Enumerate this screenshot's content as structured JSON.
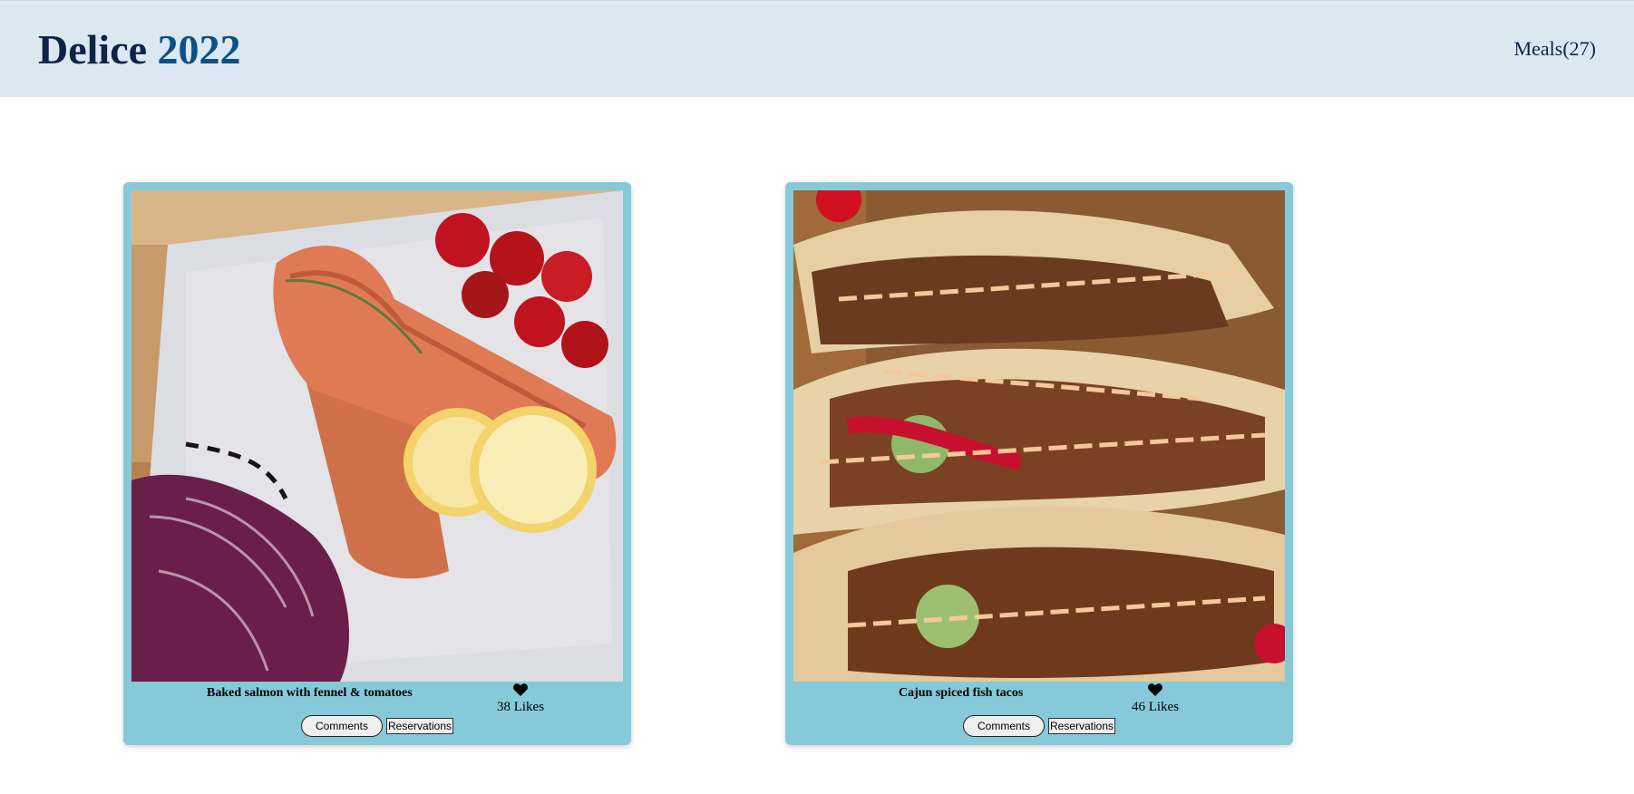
{
  "header": {
    "brand_name": "Delice",
    "brand_year": "2022",
    "nav_meals": "Meals(27)"
  },
  "meals": [
    {
      "title": "Baked salmon with fennel & tomatoes",
      "likes": "38 Likes",
      "comments_label": "Comments",
      "reservations_label": "Reservations",
      "image_icon": "food-photo-salmon"
    },
    {
      "title": "Cajun spiced fish tacos",
      "likes": "46 Likes",
      "comments_label": "Comments",
      "reservations_label": "Reservations",
      "image_icon": "food-photo-tacos"
    }
  ],
  "colors": {
    "header_bg": "#dce8f0",
    "brand_dark": "#0b2447",
    "brand_accent": "#0d4f86",
    "card_bg": "#86cad9"
  }
}
